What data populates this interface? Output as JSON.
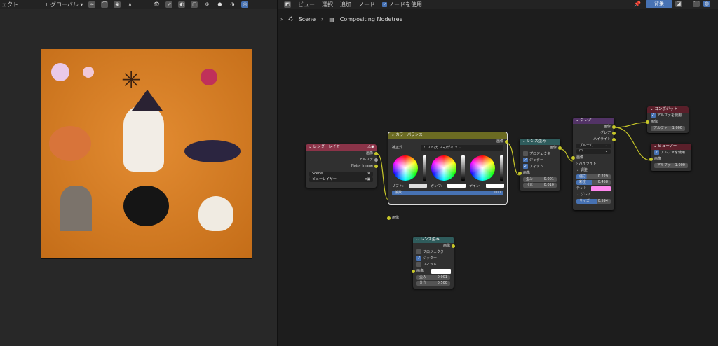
{
  "left_header": {
    "partial_menu": "ェクト",
    "orientation": "グローバル"
  },
  "node_header": {
    "menus": [
      "ビュー",
      "選択",
      "追加",
      "ノード"
    ],
    "use_nodes": "ノードを使用",
    "backdrop": "背景"
  },
  "breadcrumb": {
    "scene": "Scene",
    "tree": "Compositing Nodetree"
  },
  "render_layers": {
    "title": "レンダーレイヤー",
    "outputs": [
      "画像",
      "アルファ",
      "Noisy Image"
    ],
    "scene": "Scene",
    "view_layer": "ビューレイヤー"
  },
  "color_balance": {
    "title": "カラーバランス",
    "output": "画像",
    "formula_label": "補正式",
    "formula": "リフト/ガンマ/ゲイン",
    "lift": "リフト:",
    "gamma": "ガンマ:",
    "gain": "ゲイン:",
    "factor_label": "係数",
    "factor": "1.000",
    "input": "画像"
  },
  "lens1": {
    "title": "レンズ歪み",
    "output": "画像",
    "projector": "プロジェクター",
    "jitter": "ジッター",
    "fit": "フィット",
    "input": "画像",
    "distort_label": "歪み",
    "distort": "0.001",
    "dispersion_label": "分光",
    "dispersion": "0.010"
  },
  "lens2": {
    "title": "レンズ歪み",
    "output": "画像",
    "projector": "プロジェクター",
    "jitter": "ジッター",
    "fit": "フィット",
    "input": "画像",
    "distort_label": "歪み",
    "distort": "0.001",
    "dispersion_label": "分光",
    "dispersion": "0.500"
  },
  "glare": {
    "title": "グレア",
    "outputs": [
      "画像",
      "グレア",
      "ハイライト"
    ],
    "type": "ブルーム",
    "quality": "中",
    "input": "画像",
    "highlights": "ハイライト",
    "adjust": "調整",
    "strength_label": "強さ",
    "strength": "0.229",
    "saturation_label": "彩度",
    "saturation": "0.458",
    "tint_label": "チント",
    "tint_color": "#ff88ee",
    "glare_section": "グレア",
    "size_label": "サイズ",
    "size": "0.594"
  },
  "composite": {
    "title": "コンポジット",
    "use_alpha": "アルファを使用",
    "input": "画像",
    "alpha_label": "アルファ",
    "alpha": "1.000"
  },
  "viewer": {
    "title": "ビューアー",
    "use_alpha": "アルファを使用",
    "input": "画像",
    "alpha_label": "アルファ",
    "alpha": "1.000"
  }
}
